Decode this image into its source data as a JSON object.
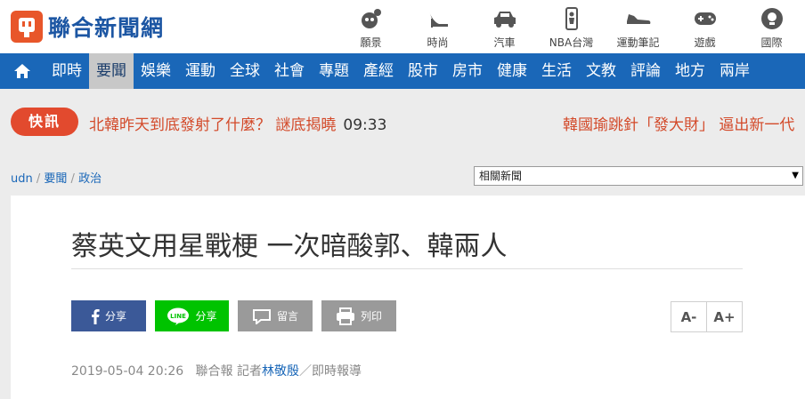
{
  "site": {
    "logo_text": "聯合新聞網"
  },
  "channels": [
    {
      "icon": "cat-icon",
      "label": "願景"
    },
    {
      "icon": "high-heel-icon",
      "label": "時尚"
    },
    {
      "icon": "car-icon",
      "label": "汽車"
    },
    {
      "icon": "nba-icon",
      "label": "NBA台灣"
    },
    {
      "icon": "sneaker-icon",
      "label": "運動筆記"
    },
    {
      "icon": "gamepad-icon",
      "label": "遊戲"
    },
    {
      "icon": "globe-icon",
      "label": "國際"
    }
  ],
  "nav": {
    "items": [
      "即時",
      "要聞",
      "娛樂",
      "運動",
      "全球",
      "社會",
      "專題",
      "產經",
      "股市",
      "房市",
      "健康",
      "生活",
      "文教",
      "評論",
      "地方",
      "兩岸"
    ],
    "active": "要聞"
  },
  "breaking": {
    "badge": "快訊",
    "headline_left": "北韓昨天到底發射了什麼？ 謎底揭曉",
    "time": "09:33",
    "headline_right": "韓國瑜跳針「發大財」 逼出新一代"
  },
  "breadcrumb": {
    "root": "udn",
    "level1": "要聞",
    "level2": "政治",
    "sep": " / "
  },
  "related_select": {
    "value": "相關新聞"
  },
  "article": {
    "title": "蔡英文用星戰梗 一次暗酸郭、韓兩人",
    "date": "2019-05-04 20:26",
    "source": "聯合報",
    "reporter_prefix": "記者",
    "reporter": "林敬殷",
    "suffix": "／即時報導"
  },
  "share": {
    "facebook": "分享",
    "line": "分享",
    "comment": "留言",
    "print": "列印",
    "line_logo": "LINE"
  },
  "font_size": {
    "decrease": "A-",
    "increase": "A+"
  },
  "colors": {
    "brand_blue": "#1a67b8",
    "breaking_red": "#e24a2e",
    "facebook": "#3b5998",
    "line": "#00c300"
  }
}
